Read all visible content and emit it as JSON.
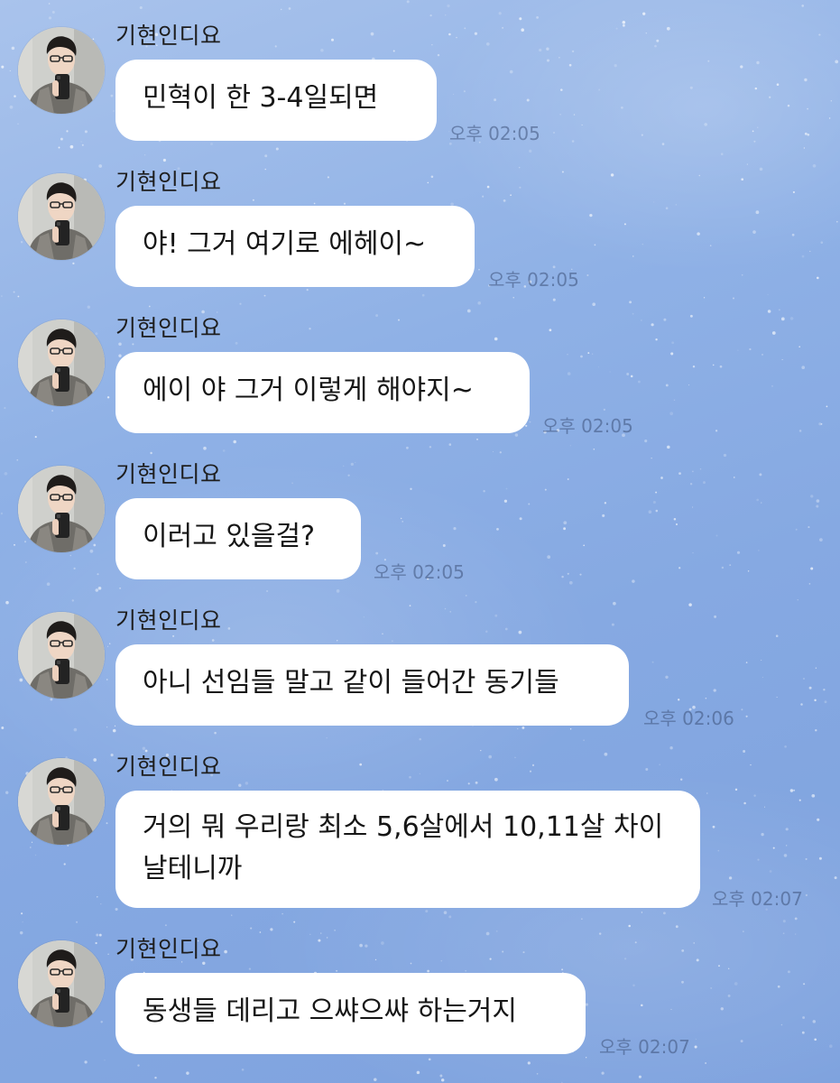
{
  "chat": {
    "background_color": "#8fb1e6",
    "bubble_color": "#ffffff",
    "messages": [
      {
        "sender": "기현인디요",
        "text": "민혁이 한 3-4일되면",
        "time": "오후 02:05"
      },
      {
        "sender": "기현인디요",
        "text": "야! 그거 여기로 에헤이~",
        "time": "오후 02:05"
      },
      {
        "sender": "기현인디요",
        "text": "에이 야 그거 이렇게 해야지~",
        "time": "오후 02:05"
      },
      {
        "sender": "기현인디요",
        "text": "이러고 있을걸?",
        "time": "오후 02:05"
      },
      {
        "sender": "기현인디요",
        "text": "아니 선임들 말고 같이 들어간 동기들",
        "time": "오후 02:06"
      },
      {
        "sender": "기현인디요",
        "text": "거의 뭐 우리랑 최소 5,6살에서 10,11살 차이 날테니까",
        "time": "오후 02:07"
      },
      {
        "sender": "기현인디요",
        "text": "동생들 데리고 으쌰으쌰 하는거지",
        "time": "오후 02:07"
      }
    ]
  }
}
